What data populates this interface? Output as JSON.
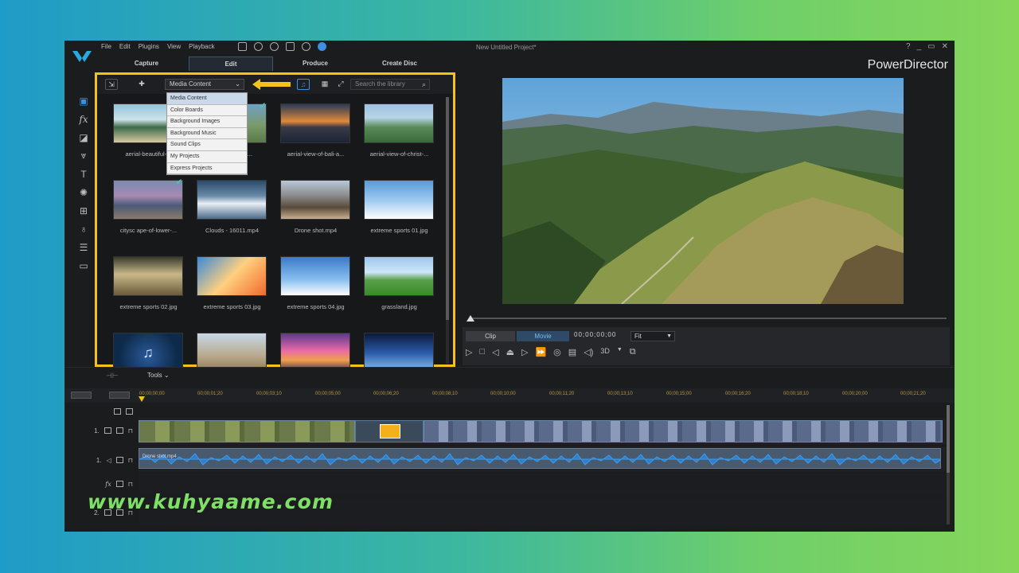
{
  "window": {
    "menu": [
      "File",
      "Edit",
      "Plugins",
      "View",
      "Playback"
    ],
    "project_title": "New Untitled Project*",
    "brand": "PowerDirector",
    "window_controls": [
      "?",
      "_",
      "▭",
      "✕"
    ]
  },
  "mode_tabs": [
    {
      "label": "Capture",
      "active": false
    },
    {
      "label": "Edit",
      "active": true
    },
    {
      "label": "Produce",
      "active": false
    },
    {
      "label": "Create Disc",
      "active": false
    }
  ],
  "rail_icons": [
    "media-room-icon",
    "fx-icon",
    "pip-icon",
    "transition-icon",
    "title-icon",
    "particle-icon",
    "chapter-icon",
    "voice-icon",
    "subtitle-icon",
    "audio-mix-icon"
  ],
  "library": {
    "content_select": "Media Content",
    "search_placeholder": "Search the library",
    "dropdown_options": [
      "Media Content",
      "Color Boards",
      "Background Images",
      "Background Music",
      "Sound Clips",
      "My Projects",
      "Express Projects"
    ],
    "items": [
      {
        "name": "aerial-beautiful-...",
        "checked": false
      },
      {
        "name": "aerial-view-m...",
        "checked": true
      },
      {
        "name": "aerial-view-of-bali-a...",
        "checked": false
      },
      {
        "name": "aerial-view-of-christ-...",
        "checked": false
      },
      {
        "name": "citysc ape-of-lower-...",
        "checked": true
      },
      {
        "name": "Clouds - 16011.mp4",
        "checked": false
      },
      {
        "name": "Drone shot.mp4",
        "checked": false
      },
      {
        "name": "extreme sports 01.jpg",
        "checked": false
      },
      {
        "name": "extreme sports 02.jpg",
        "checked": false
      },
      {
        "name": "extreme sports 03.jpg",
        "checked": false
      },
      {
        "name": "extreme sports 04.jpg",
        "checked": false
      },
      {
        "name": "grassland.jpg",
        "checked": false
      },
      {
        "name": "",
        "checked": false
      },
      {
        "name": "",
        "checked": false
      },
      {
        "name": "",
        "checked": false
      },
      {
        "name": "",
        "checked": false
      }
    ]
  },
  "preview": {
    "mode_clip": "Clip",
    "mode_movie": "Movie",
    "timecode": "00;00;00;00",
    "fit": "Fit",
    "transport_3d": "3D"
  },
  "timeline": {
    "tools_label": "Tools",
    "ruler": [
      "00;00;00;00",
      "00;00;01;20",
      "00;00;03;10",
      "00;00;05;00",
      "00;00;06;20",
      "00;00;08;10",
      "00;00;10;00",
      "00;00;11;20",
      "00;00;13;10",
      "00;00;15;00",
      "00;00;16;20",
      "00;00;18;10",
      "00;00;20;00",
      "00;00;21;20"
    ],
    "tracks": [
      {
        "label": "1."
      },
      {
        "label": "1."
      },
      {
        "label": "fx"
      },
      {
        "label": "2."
      }
    ],
    "audio_clip_label": "Drone shot.mp4"
  },
  "watermark": "www.kuhyaame.com",
  "colors": {
    "highlight_frame": "#f4c21b",
    "accent_blue": "#3d8fe0",
    "watermark": "#7fe067"
  }
}
